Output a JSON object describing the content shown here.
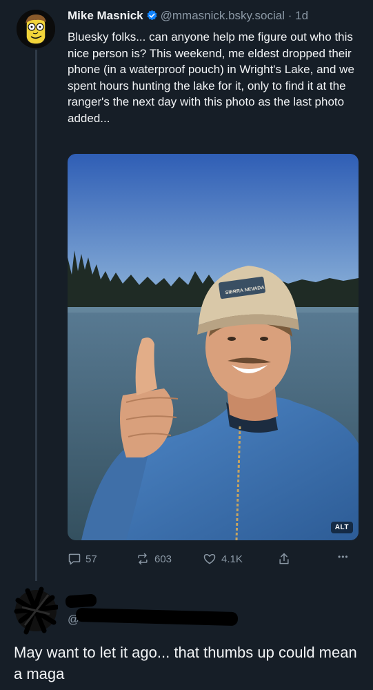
{
  "post": {
    "author_name": "Mike Masnick",
    "handle": "@mmasnick.bsky.social",
    "separator": "·",
    "time": "1d",
    "text": "Bluesky folks... can anyone help me figure out who this nice person is? This weekend, me eldest dropped their phone (in a waterproof pouch) in Wright's Lake, and we spent hours hunting the lake for it, only to find it at the ranger's the next day with this photo as the last photo added...",
    "image_alt_badge": "ALT",
    "cap_text": "SIERRA NEVADA",
    "icons": {
      "avatar": "cartoon-avatar",
      "verified": "verified-check-icon",
      "reply": "speech-bubble-icon",
      "repost": "repost-icon",
      "like": "heart-icon",
      "share": "share-icon",
      "more": "more-dots-icon"
    }
  },
  "actions": {
    "replies": "57",
    "reposts": "603",
    "likes": "4.1K",
    "more": "•••"
  },
  "reply": {
    "handle_glyph": "@",
    "text": "May want to let it ago... that thumbs up could mean a maga"
  },
  "colors": {
    "background": "#161e27",
    "text": "#f1f3f5",
    "muted": "#8b98a5",
    "verified": "#1083fe"
  }
}
